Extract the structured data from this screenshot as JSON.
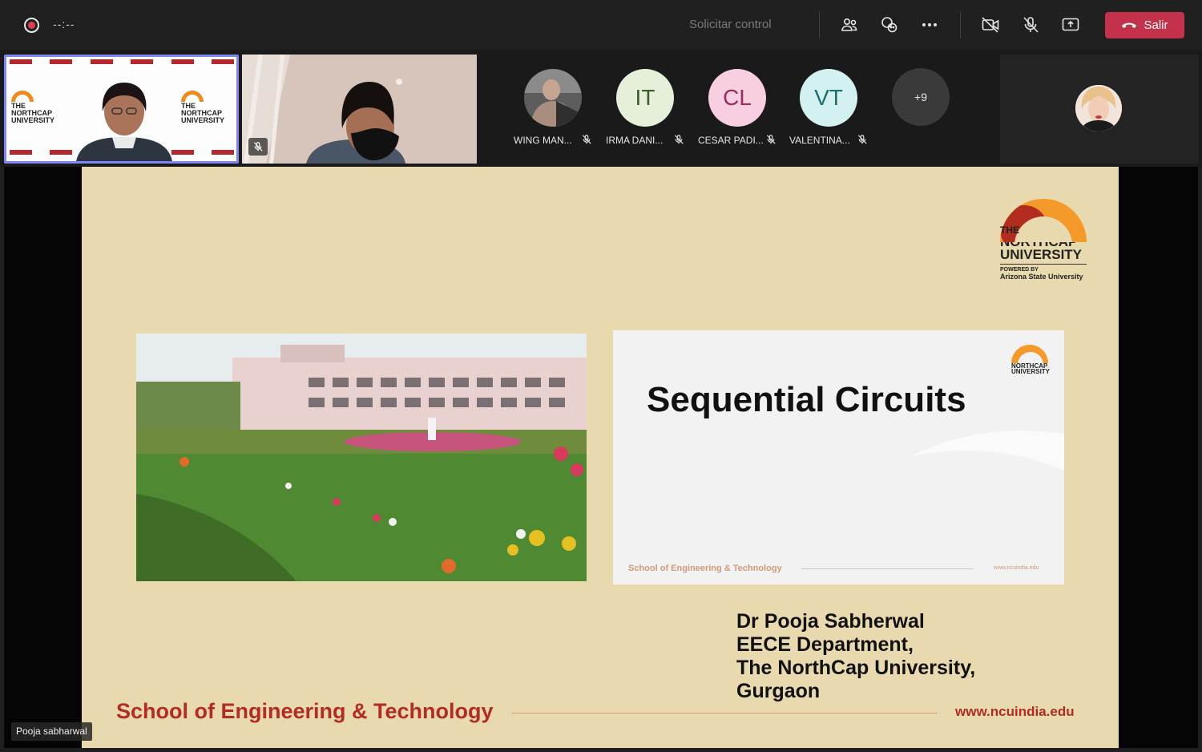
{
  "topbar": {
    "timer": "--:--",
    "request_control": "Solicitar control",
    "leave_label": "Salir",
    "icons": [
      "record-icon",
      "people-icon",
      "chat-icon",
      "more-icon",
      "camera-off-icon",
      "mic-off-icon",
      "share-icon",
      "phone-hangup-icon"
    ]
  },
  "participants": {
    "avatars": [
      {
        "name": "WING MAN...",
        "initials": "",
        "bg": "#6a6a6a",
        "fg": "#ffffff"
      },
      {
        "name": "IRMA DANI...",
        "initials": "IT",
        "bg": "#e6efd9",
        "fg": "#3d5a2a"
      },
      {
        "name": "CESAR PADI...",
        "initials": "CL",
        "bg": "#f7cfe0",
        "fg": "#9b2a5d"
      },
      {
        "name": "VALENTINA...",
        "initials": "VT",
        "bg": "#d2f1f0",
        "fg": "#1f6e72"
      }
    ],
    "overflow": "+9"
  },
  "slide": {
    "inner_title": "Sequential Circuits",
    "inner_school": "School of Engineering & Technology",
    "inner_url": "www.ncuindia.edu",
    "presenter": [
      "Dr Pooja Sabherwal",
      "EECE Department,",
      "The NorthCap University,",
      "Gurgaon"
    ],
    "school": "School of Engineering & Technology",
    "url": "www.ncuindia.edu",
    "logo": {
      "the": "THE",
      "name1": "NORTHCAP",
      "name2": "UNIVERSITY",
      "powered": "POWERED BY",
      "asu": "Arizona State University"
    }
  },
  "speaker_label": "Pooja sabharwal",
  "colors": {
    "accent": "#7f85f5",
    "leave": "#c4314b",
    "slide_bg": "#e9d9ae",
    "brand_red": "#b12d23"
  }
}
